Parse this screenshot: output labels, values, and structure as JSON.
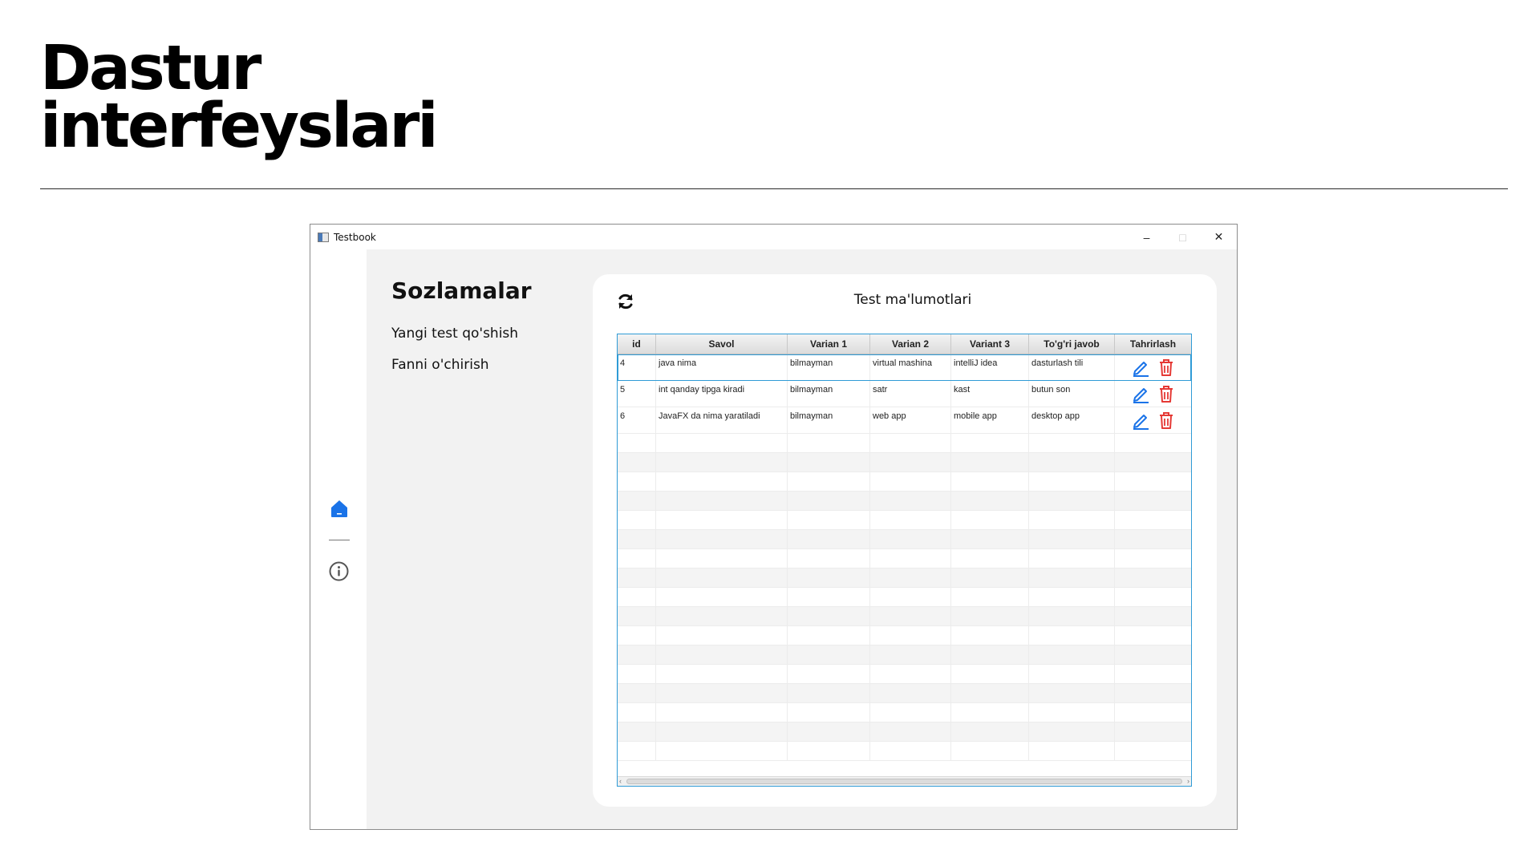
{
  "slide": {
    "title_line1": "Dastur",
    "title_line2": "interfeyslari"
  },
  "window": {
    "title": "Testbook",
    "controls": {
      "minimize": "–",
      "maximize": "□",
      "close": "✕"
    }
  },
  "sidebar": {
    "icons": [
      "home-icon",
      "info-icon"
    ],
    "accent": "#1a73e8"
  },
  "settings": {
    "title": "Sozlamalar",
    "links": [
      "Yangi test qo'shish",
      "Fanni o'chirish"
    ]
  },
  "card": {
    "title": "Test ma'lumotlari",
    "refresh_icon": "refresh-icon"
  },
  "table": {
    "columns": [
      "id",
      "Savol",
      "Varian 1",
      "Varian 2",
      "Variant 3",
      "To'g'ri javob",
      "Tahrirlash"
    ],
    "rows": [
      {
        "id": "4",
        "savol": "java nima",
        "v1": "bilmayman",
        "v2": "virtual mashina",
        "v3": "intelliJ idea",
        "tj": "dasturlash tili"
      },
      {
        "id": "5",
        "savol": "int qanday tipga kiradi",
        "v1": "bilmayman",
        "v2": "satr",
        "v3": "kast",
        "tj": "butun son"
      },
      {
        "id": "6",
        "savol": "JavaFX da nima yaratiladi",
        "v1": "bilmayman",
        "v2": "web app",
        "v3": "mobile app",
        "tj": "desktop app"
      }
    ],
    "edit_color": "#1a73e8",
    "delete_color": "#e53935",
    "selection_color": "#2f9bd6"
  }
}
